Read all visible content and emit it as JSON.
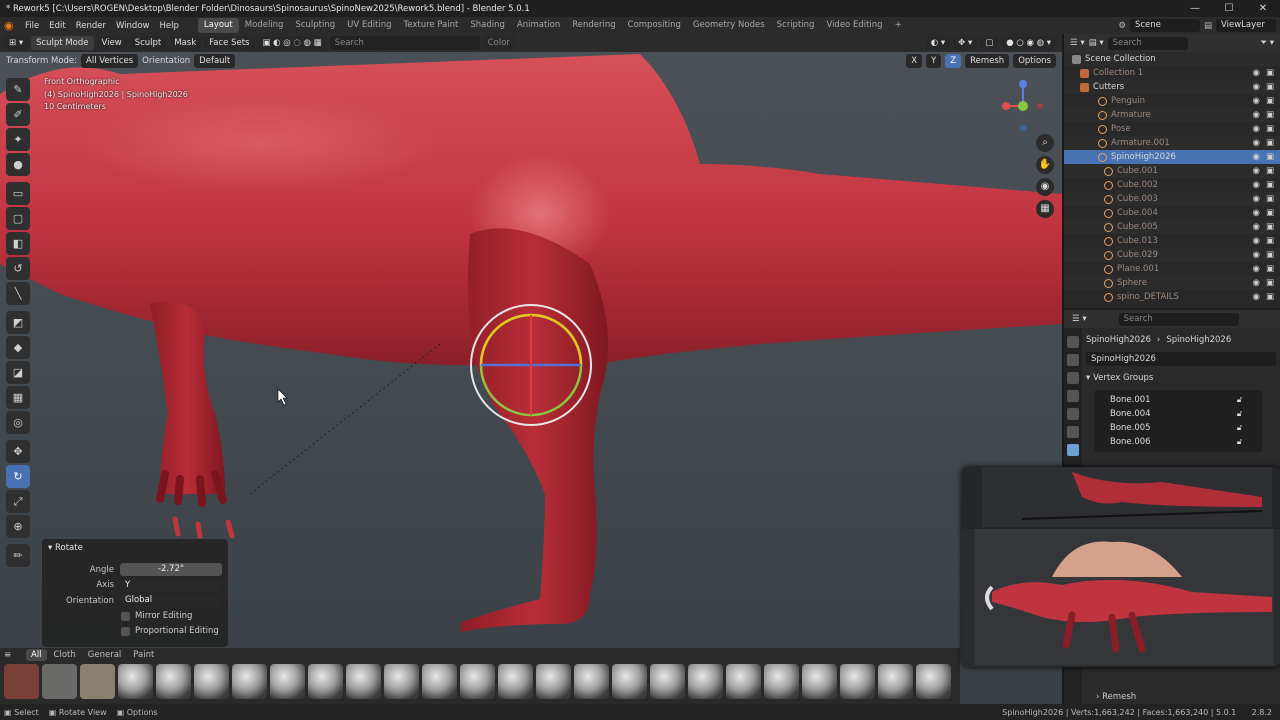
{
  "window": {
    "title": "* Rework5 [C:\\Users\\ROGEN\\Desktop\\Blender Folder\\Dinosaurs\\Spinosaurus\\SpinoNew2025\\Rework5.blend] - Blender 5.0.1",
    "controls": [
      "—",
      "☐",
      "✕"
    ]
  },
  "menus": [
    "File",
    "Edit",
    "Render",
    "Window",
    "Help"
  ],
  "workspaces": [
    "Layout",
    "Modeling",
    "Sculpting",
    "UV Editing",
    "Texture Paint",
    "Shading",
    "Animation",
    "Rendering",
    "Compositing",
    "Geometry Nodes",
    "Scripting",
    "Video Editing"
  ],
  "active_workspace": "Layout",
  "add_workspace": "+",
  "scene": "Scene",
  "view_layer": "ViewLayer",
  "viewport": {
    "mode": "Sculpt Mode",
    "header_menus": [
      "View",
      "Sculpt",
      "Mask",
      "Face Sets"
    ],
    "search_placeholder": "Search",
    "color_label": "Color",
    "transform_mode_label": "Transform Mode:",
    "transform_mode_value": "All Vertices",
    "orientation_label": "Orientation",
    "orientation_value": "Default",
    "axes": [
      "X",
      "Y",
      "Z"
    ],
    "remesh_label": "Remesh",
    "options_label": "Options",
    "overlay_lines": [
      "Front Orthographic",
      "(4) SpinoHigh2026 | SpinoHigh2026",
      "10 Centimeters"
    ]
  },
  "redo_panel": {
    "title": "Rotate",
    "angle_label": "Angle",
    "angle_value": "-2.72°",
    "axis_label": "Axis",
    "axis_value": "Y",
    "orientation_label": "Orientation",
    "orientation_value": "Global",
    "mirror_editing": "Mirror Editing",
    "proportional_editing": "Proportional Editing"
  },
  "shelf": {
    "tabs": [
      "All",
      "Cloth",
      "General",
      "Paint"
    ],
    "active_tab": "All"
  },
  "outliner": {
    "search_placeholder": "Search",
    "root": "Scene Collection",
    "rows": [
      {
        "name": "Collection 1",
        "dim": true
      },
      {
        "name": "Cutters",
        "dim": false
      },
      {
        "name": "Penguin",
        "dim": true
      },
      {
        "name": "Armature",
        "dim": true
      },
      {
        "name": "Pose",
        "dim": true
      },
      {
        "name": "Armature.001",
        "dim": true
      },
      {
        "name": "SpinoHigh2026",
        "dim": false,
        "selected": true
      },
      {
        "name": "Cube.001",
        "dim": true
      },
      {
        "name": "Cube.002",
        "dim": true
      },
      {
        "name": "Cube.003",
        "dim": true
      },
      {
        "name": "Cube.004",
        "dim": true
      },
      {
        "name": "Cube.005",
        "dim": true
      },
      {
        "name": "Cube.013",
        "dim": true
      },
      {
        "name": "Cube.029",
        "dim": true
      },
      {
        "name": "Plane.001",
        "dim": true
      },
      {
        "name": "Sphere",
        "dim": true
      },
      {
        "name": "spino_DETAILS",
        "dim": true
      }
    ]
  },
  "properties": {
    "search_placeholder": "Search",
    "breadcrumb_object": "SpinoHigh2026",
    "breadcrumb_mesh": "SpinoHigh2026",
    "mesh_name": "SpinoHigh2026",
    "section": "Vertex Groups",
    "vertex_groups": [
      "Bone.001",
      "Bone.004",
      "Bone.005",
      "Bone.006"
    ],
    "footer": "Remesh"
  },
  "status_bar": {
    "select": "Select",
    "rotate_view": "Rotate View",
    "options": "Options",
    "stats": "SpinoHigh2026 | Verts:1,663,242 | Faces:1,663,240 | 5.0.1",
    "right": "2.8.2"
  },
  "colors": {
    "accent": "#4772b3",
    "model_red": "#c0343f",
    "blender_orange": "#e87d0d"
  }
}
